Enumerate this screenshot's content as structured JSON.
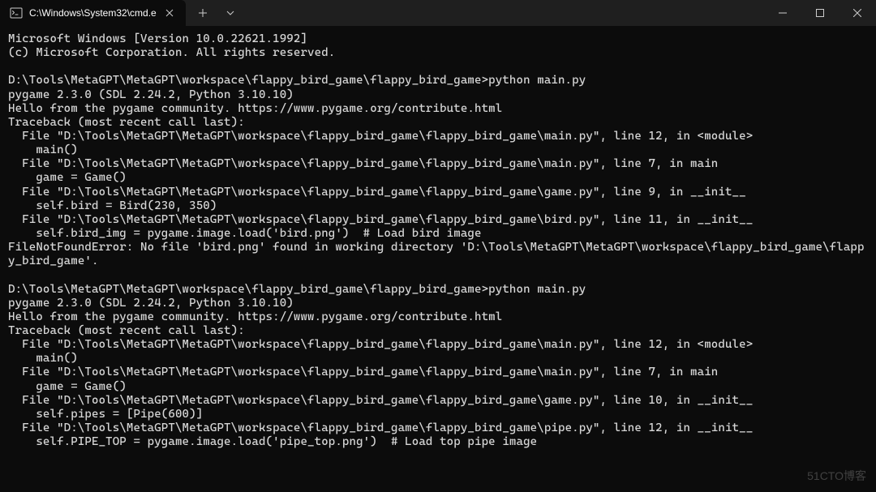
{
  "titlebar": {
    "tab_title": "C:\\Windows\\System32\\cmd.e",
    "new_tab_tooltip": "+",
    "dropdown_tooltip": "v"
  },
  "terminal_lines": [
    "Microsoft Windows [Version 10.0.22621.1992]",
    "(c) Microsoft Corporation. All rights reserved.",
    "",
    "D:\\Tools\\MetaGPT\\MetaGPT\\workspace\\flappy_bird_game\\flappy_bird_game>python main.py",
    "pygame 2.3.0 (SDL 2.24.2, Python 3.10.10)",
    "Hello from the pygame community. https://www.pygame.org/contribute.html",
    "Traceback (most recent call last):",
    "  File \"D:\\Tools\\MetaGPT\\MetaGPT\\workspace\\flappy_bird_game\\flappy_bird_game\\main.py\", line 12, in <module>",
    "    main()",
    "  File \"D:\\Tools\\MetaGPT\\MetaGPT\\workspace\\flappy_bird_game\\flappy_bird_game\\main.py\", line 7, in main",
    "    game = Game()",
    "  File \"D:\\Tools\\MetaGPT\\MetaGPT\\workspace\\flappy_bird_game\\flappy_bird_game\\game.py\", line 9, in __init__",
    "    self.bird = Bird(230, 350)",
    "  File \"D:\\Tools\\MetaGPT\\MetaGPT\\workspace\\flappy_bird_game\\flappy_bird_game\\bird.py\", line 11, in __init__",
    "    self.bird_img = pygame.image.load('bird.png')  # Load bird image",
    "FileNotFoundError: No file 'bird.png' found in working directory 'D:\\Tools\\MetaGPT\\MetaGPT\\workspace\\flappy_bird_game\\flappy_bird_game'.",
    "",
    "D:\\Tools\\MetaGPT\\MetaGPT\\workspace\\flappy_bird_game\\flappy_bird_game>python main.py",
    "pygame 2.3.0 (SDL 2.24.2, Python 3.10.10)",
    "Hello from the pygame community. https://www.pygame.org/contribute.html",
    "Traceback (most recent call last):",
    "  File \"D:\\Tools\\MetaGPT\\MetaGPT\\workspace\\flappy_bird_game\\flappy_bird_game\\main.py\", line 12, in <module>",
    "    main()",
    "  File \"D:\\Tools\\MetaGPT\\MetaGPT\\workspace\\flappy_bird_game\\flappy_bird_game\\main.py\", line 7, in main",
    "    game = Game()",
    "  File \"D:\\Tools\\MetaGPT\\MetaGPT\\workspace\\flappy_bird_game\\flappy_bird_game\\game.py\", line 10, in __init__",
    "    self.pipes = [Pipe(600)]",
    "  File \"D:\\Tools\\MetaGPT\\MetaGPT\\workspace\\flappy_bird_game\\flappy_bird_game\\pipe.py\", line 12, in __init__",
    "    self.PIPE_TOP = pygame.image.load('pipe_top.png')  # Load top pipe image"
  ],
  "watermark": "51CTO博客"
}
